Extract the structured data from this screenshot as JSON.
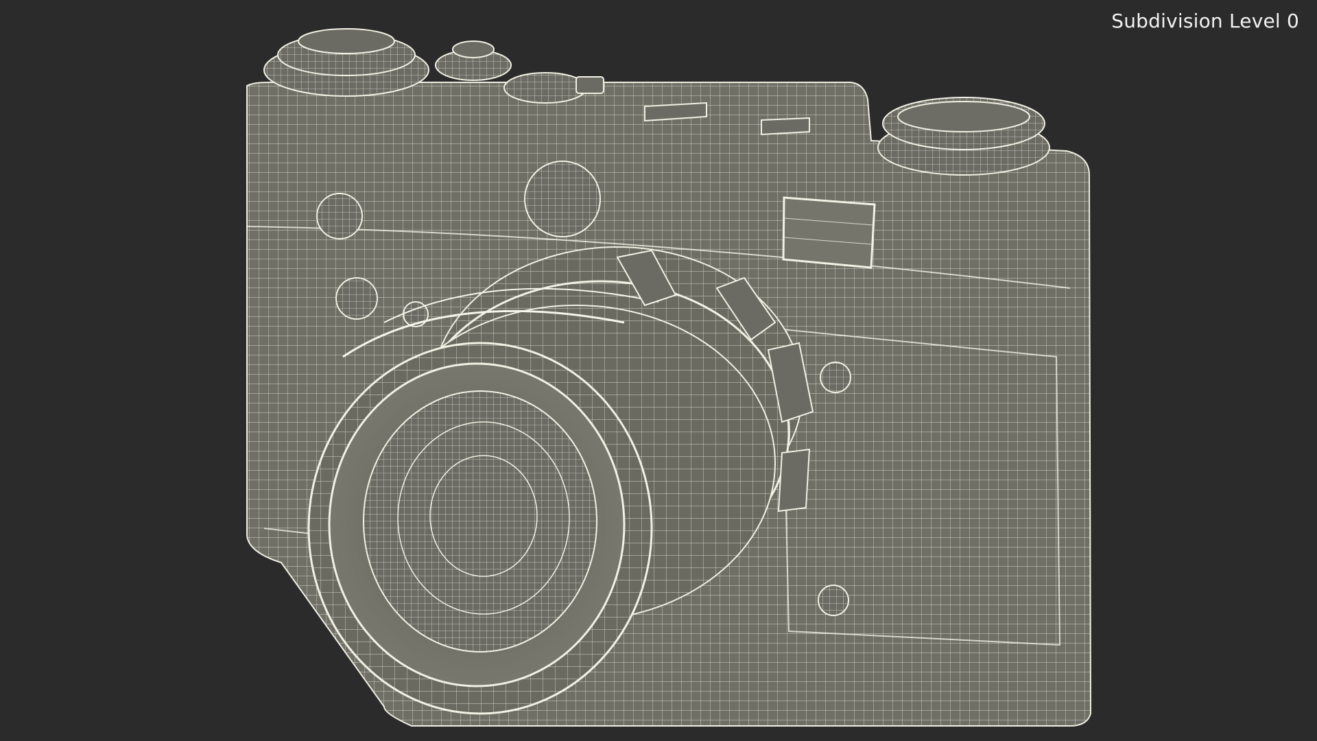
{
  "viewport": {
    "overlay_label": "Subdivision Level 0",
    "background_color": "#2b2b2b",
    "wire_color": "#e7e7dc",
    "shade_color": "#7c7c72"
  },
  "model": {
    "parts": [
      "camera-body-icon",
      "lens-icon",
      "shutter-dial-icon",
      "rewind-knob-icon",
      "viewfinder-window-icon",
      "rangefinder-window-icon",
      "screw-icon"
    ]
  }
}
